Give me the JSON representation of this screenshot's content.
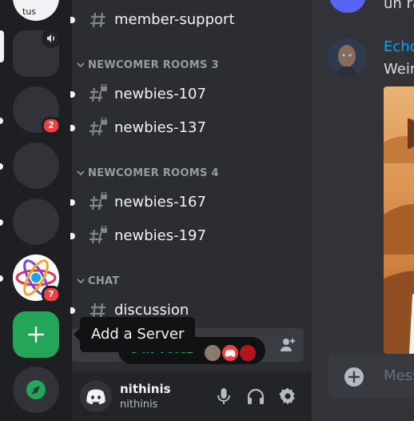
{
  "servers": [
    {
      "name": "server-top",
      "badge": null
    },
    {
      "name": "server-2",
      "badge": null
    },
    {
      "name": "server-3",
      "badge": "2"
    },
    {
      "name": "server-4",
      "badge": null
    },
    {
      "name": "server-5",
      "badge": null
    },
    {
      "name": "react-server",
      "badge": "7"
    }
  ],
  "sidebar": {
    "top_channel": "member-support",
    "categories": [
      {
        "label": "NEWCOMER ROOMS 3",
        "channels": [
          "newbies-107",
          "newbies-137"
        ]
      },
      {
        "label": "NEWCOMER ROOMS 4",
        "channels": [
          "newbies-167",
          "newbies-197"
        ]
      },
      {
        "label": "CHAT",
        "channels": [
          "discussion"
        ]
      }
    ],
    "voice_text": "3 IN VOICE"
  },
  "tooltip": "Add a Server",
  "user": {
    "name": "nithinis",
    "handle": "nithinis"
  },
  "chat": {
    "top_text": "un ra",
    "author": "Echo",
    "message": "Weir",
    "input_placeholder": "Mess"
  },
  "colors": {
    "accent_green": "#23a55a",
    "badge_red": "#f23f43",
    "link_blue": "#00a8fc",
    "blurple": "#5865f2"
  }
}
